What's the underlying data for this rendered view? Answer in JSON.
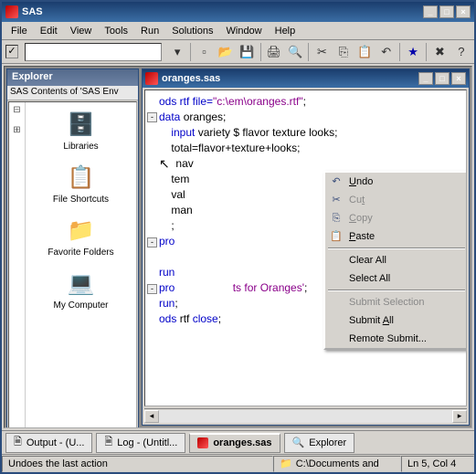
{
  "app": {
    "title": "SAS"
  },
  "menu": {
    "items": [
      "File",
      "Edit",
      "View",
      "Tools",
      "Run",
      "Solutions",
      "Window",
      "Help"
    ]
  },
  "toolbar": {
    "cmd_value": ""
  },
  "explorer": {
    "title": "Explorer",
    "subtitle": "SAS Contents of 'SAS Env",
    "items": [
      {
        "label": "Libraries",
        "icon": "🗄️"
      },
      {
        "label": "File Shortcuts",
        "icon": "📋"
      },
      {
        "label": "Favorite Folders",
        "icon": "📁"
      },
      {
        "label": "My Computer",
        "icon": "💻"
      }
    ]
  },
  "editor": {
    "title": "oranges.sas",
    "code": {
      "l1": "ods rtf file=",
      "l1s": "\"c:\\em\\oranges.rtf\"",
      "l1e": ";",
      "l2a": "data",
      "l2b": " oranges;",
      "l3a": "input",
      "l3b": " variety $ flavor texture looks;",
      "l4": "    total=flavor+texture+looks;",
      "l5h": "nav",
      "l6h": "tem",
      "l7h": "val",
      "l8h": "man",
      "l9": "    ;",
      "l10a": "pro",
      "l12a": "run",
      "l13a": "pro",
      "l13b": "ts for Oranges'",
      "l13c": ";",
      "l14a": "run",
      "l14b": ";",
      "l15a": "ods",
      "l15b": " rtf ",
      "l15c": "close",
      "l15d": ";"
    }
  },
  "context_menu": {
    "items": [
      {
        "label": "Undo",
        "key": "U",
        "icon": "↶",
        "enabled": true
      },
      {
        "label": "Cut",
        "key": "t",
        "icon": "✂",
        "enabled": false
      },
      {
        "label": "Copy",
        "key": "C",
        "icon": "⎘",
        "enabled": false
      },
      {
        "label": "Paste",
        "key": "P",
        "icon": "📋",
        "enabled": true
      },
      {
        "sep": true
      },
      {
        "label": "Clear All",
        "key": "",
        "icon": "",
        "enabled": true
      },
      {
        "label": "Select All",
        "key": "",
        "icon": "",
        "enabled": true
      },
      {
        "sep": true
      },
      {
        "label": "Submit Selection",
        "key": "",
        "icon": "",
        "enabled": false
      },
      {
        "label": "Submit All",
        "key": "A",
        "icon": "",
        "enabled": true
      },
      {
        "label": "Remote Submit...",
        "key": "",
        "icon": "",
        "enabled": true
      }
    ]
  },
  "tabs": {
    "items": [
      {
        "label": "Output - (U...",
        "active": false
      },
      {
        "label": "Log - (Untitl...",
        "active": false
      },
      {
        "label": "oranges.sas",
        "active": true
      },
      {
        "label": "Explorer",
        "active": false
      }
    ]
  },
  "status": {
    "hint": "Undoes the last action",
    "path": "C:\\Documents and",
    "pos": "Ln 5, Col 4"
  }
}
